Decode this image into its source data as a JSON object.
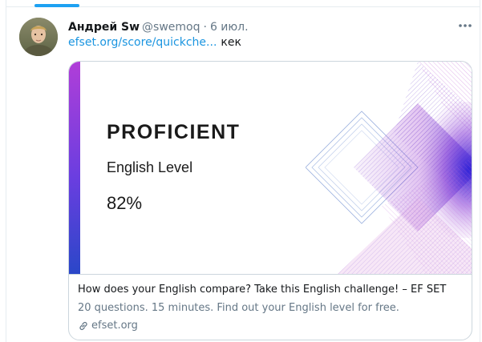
{
  "tweet": {
    "author": {
      "name": "Андрей Sw",
      "handle": "@swemoq",
      "separator": "·",
      "timestamp": "6 июл."
    },
    "text": {
      "link": "efset.org/score/quickche...",
      "word": "кек"
    },
    "more_icon": "more-horizontal-icon",
    "avatar_icon": "user-avatar"
  },
  "card": {
    "image": {
      "level": "PROFICIENT",
      "level_label": "English Level",
      "score": "82%"
    },
    "title": "How does your English compare? Take this English challenge! – EF SET",
    "description": "20 questions. 15 minutes. Find out your English level for free.",
    "domain": "efset.org",
    "domain_icon": "link-icon"
  },
  "colors": {
    "link": "#1b95e0",
    "text_primary": "#14171a",
    "text_secondary": "#657786",
    "border": "#ccd6dd",
    "tab_accent": "#1da1f2",
    "pattern_purple": "#a23fd1",
    "pattern_blue": "#2c1fd6"
  }
}
